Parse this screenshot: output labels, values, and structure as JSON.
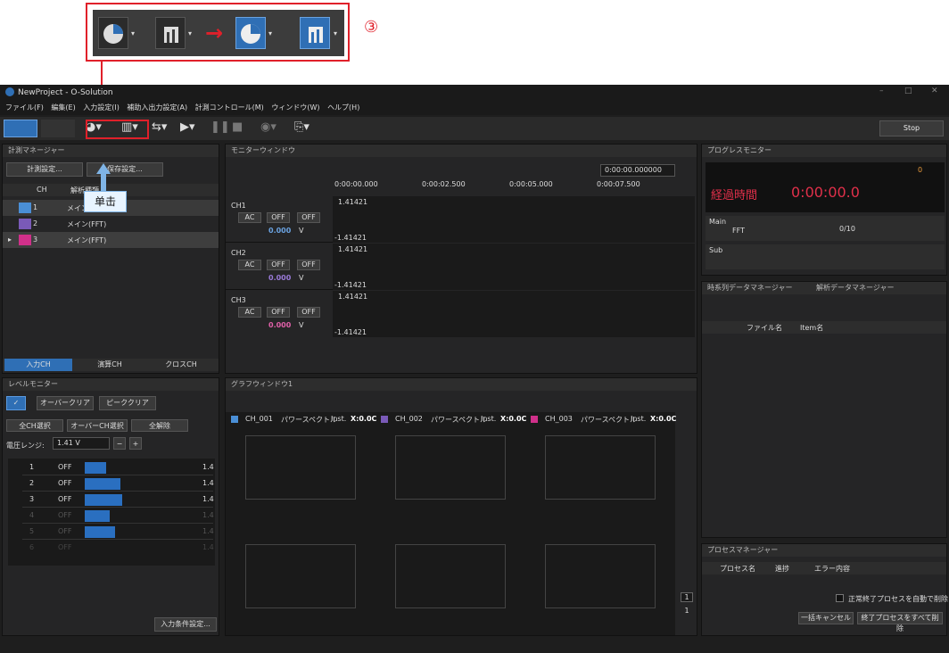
{
  "callout": {
    "step": "③",
    "arrow": "→"
  },
  "window": {
    "title": "NewProject - O-Solution",
    "stop": "Stop"
  },
  "menu": [
    "ファイル(F)",
    "編集(E)",
    "入力設定(I)",
    "補助入出力設定(A)",
    "計測コントロール(M)",
    "ウィンドウ(W)",
    "ヘルプ(H)"
  ],
  "measure_manager": {
    "title": "計測マネージャー",
    "btn_measure": "計測設定...",
    "btn_save": "保存設定...",
    "col_ch": "CH",
    "col_name": "解析種類",
    "rows": [
      {
        "ch": "1",
        "name": "メイン(FFT)",
        "color": "#4a8fd6"
      },
      {
        "ch": "2",
        "name": "メイン(FFT)",
        "color": "#7a5ab8"
      },
      {
        "ch": "3",
        "name": "メイン(FFT)",
        "color": "#d0308a"
      }
    ],
    "tabs": [
      "入力CH",
      "演算CH",
      "クロスCH"
    ]
  },
  "tooltip": "单击",
  "level_monitor": {
    "title": "レベルモニター",
    "over_clear": "オーバークリア",
    "peak_clear": "ピーククリア",
    "all_ch": "全CH選択",
    "over_ch": "オーバーCH選択",
    "all_release": "全解除",
    "range_label": "電圧レンジ:",
    "range_value": "1.41 V",
    "rows": [
      {
        "n": "1",
        "off": "OFF",
        "val": "1.4"
      },
      {
        "n": "2",
        "off": "OFF",
        "val": "1.4"
      },
      {
        "n": "3",
        "off": "OFF",
        "val": "1.4"
      },
      {
        "n": "4",
        "off": "OFF",
        "val": "1.4"
      },
      {
        "n": "5",
        "off": "OFF",
        "val": "1.4"
      },
      {
        "n": "6",
        "off": "OFF",
        "val": "1.4"
      }
    ],
    "input_cond": "入力条件設定..."
  },
  "monitor": {
    "title": "モニターウィンドウ",
    "time": "0:00:00.000000",
    "ticks": [
      "0:00:00.000",
      "0:00:02.500",
      "0:00:05.000",
      "0:00:07.500"
    ],
    "channels": [
      {
        "name": "CH1",
        "ac": "AC",
        "off1": "OFF",
        "off2": "OFF",
        "val": "0.000",
        "unit": "V",
        "top": "1.41421",
        "bottom": "-1.41421"
      },
      {
        "name": "CH2",
        "ac": "AC",
        "off1": "OFF",
        "off2": "OFF",
        "val": "0.000",
        "unit": "V",
        "top": "1.41421",
        "bottom": "-1.41421"
      },
      {
        "name": "CH3",
        "ac": "AC",
        "off1": "OFF",
        "off2": "OFF",
        "val": "0.000",
        "unit": "V",
        "top": "1.41421",
        "bottom": "-1.41421"
      }
    ]
  },
  "graph": {
    "title": "グラフウィンドウ1",
    "labels": [
      {
        "ch": "CH_001",
        "kind": "パワースペクトル",
        "inst": "Inst.",
        "x": "X:0.0C",
        "color": "#4a8fd6"
      },
      {
        "ch": "CH_002",
        "kind": "パワースペクトル",
        "inst": "Inst.",
        "x": "X:0.0C",
        "color": "#7a5ab8"
      },
      {
        "ch": "CH_003",
        "kind": "パワースペクトル",
        "inst": "Inst.",
        "x": "X:0.0C",
        "color": "#d0308a"
      }
    ],
    "page": "1",
    "page2": "1"
  },
  "progress": {
    "title": "プログレスモニター",
    "count": "0",
    "elapsed_label": "経過時間",
    "elapsed": "0:00:00.0",
    "main": "Main",
    "fft": "FFT",
    "fft_val": "0/10",
    "sub": "Sub"
  },
  "data_manager": {
    "tab1": "時系列データマネージャー",
    "tab2": "解析データマネージャー",
    "col_file": "ファイル名",
    "col_item": "Item名"
  },
  "process_manager": {
    "title": "プロセスマネージャー",
    "col_name": "プロセス名",
    "col_progress": "進捗",
    "col_error": "エラー内容",
    "auto_delete": "正常終了プロセスを自動で削除",
    "cancel_all": "一括キャンセル",
    "delete_done": "終了プロセスをすべて削除"
  }
}
